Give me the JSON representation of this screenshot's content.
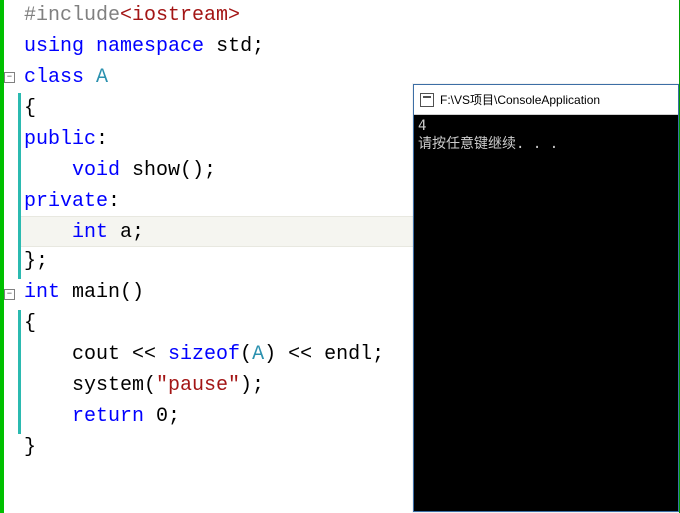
{
  "editor": {
    "lines": [
      {
        "indent": 0,
        "tokens": [
          {
            "t": "#include",
            "c": "pp"
          },
          {
            "t": "<iostream>",
            "c": "inc"
          }
        ]
      },
      {
        "indent": 0,
        "tokens": [
          {
            "t": "using",
            "c": "kw"
          },
          {
            "t": " ",
            "c": "op"
          },
          {
            "t": "namespace",
            "c": "kw"
          },
          {
            "t": " std;",
            "c": "op"
          }
        ]
      },
      {
        "indent": 0,
        "fold": true,
        "tokens": [
          {
            "t": "class",
            "c": "kw"
          },
          {
            "t": " ",
            "c": "op"
          },
          {
            "t": "A",
            "c": "ty"
          }
        ]
      },
      {
        "indent": 0,
        "cyan": true,
        "tokens": [
          {
            "t": "{",
            "c": "op"
          }
        ]
      },
      {
        "indent": 0,
        "cyan": true,
        "tokens": [
          {
            "t": "public",
            "c": "kw"
          },
          {
            "t": ":",
            "c": "op"
          }
        ]
      },
      {
        "indent": 1,
        "cyan": true,
        "tokens": [
          {
            "t": "void",
            "c": "kw"
          },
          {
            "t": " show();",
            "c": "op"
          }
        ]
      },
      {
        "indent": 0,
        "cyan": true,
        "tokens": [
          {
            "t": "private",
            "c": "kw"
          },
          {
            "t": ":",
            "c": "op"
          }
        ]
      },
      {
        "indent": 1,
        "cyan": true,
        "highlight": true,
        "tokens": [
          {
            "t": "int",
            "c": "kw"
          },
          {
            "t": " a;",
            "c": "op"
          }
        ]
      },
      {
        "indent": 0,
        "cyan": true,
        "tokens": [
          {
            "t": "};",
            "c": "op"
          }
        ]
      },
      {
        "indent": 0,
        "fold": true,
        "tokens": [
          {
            "t": "int",
            "c": "kw"
          },
          {
            "t": " main()",
            "c": "op"
          }
        ]
      },
      {
        "indent": 0,
        "cyan": true,
        "tokens": [
          {
            "t": "{",
            "c": "op"
          }
        ]
      },
      {
        "indent": 1,
        "cyan": true,
        "tokens": [
          {
            "t": "cout << ",
            "c": "op"
          },
          {
            "t": "sizeof",
            "c": "kw"
          },
          {
            "t": "(",
            "c": "op"
          },
          {
            "t": "A",
            "c": "ty"
          },
          {
            "t": ") << endl;",
            "c": "op"
          }
        ]
      },
      {
        "indent": 1,
        "cyan": true,
        "tokens": [
          {
            "t": "system(",
            "c": "op"
          },
          {
            "t": "\"pause\"",
            "c": "str"
          },
          {
            "t": ");",
            "c": "op"
          }
        ]
      },
      {
        "indent": 1,
        "cyan": true,
        "tokens": [
          {
            "t": "return",
            "c": "kw"
          },
          {
            "t": " 0;",
            "c": "op"
          }
        ]
      },
      {
        "indent": 0,
        "tokens": [
          {
            "t": "}",
            "c": "op"
          }
        ]
      }
    ],
    "fold_glyph": "−"
  },
  "console": {
    "title": "F:\\VS项目\\ConsoleApplication",
    "output_line1": "4",
    "output_line2": "请按任意键继续. . ."
  }
}
